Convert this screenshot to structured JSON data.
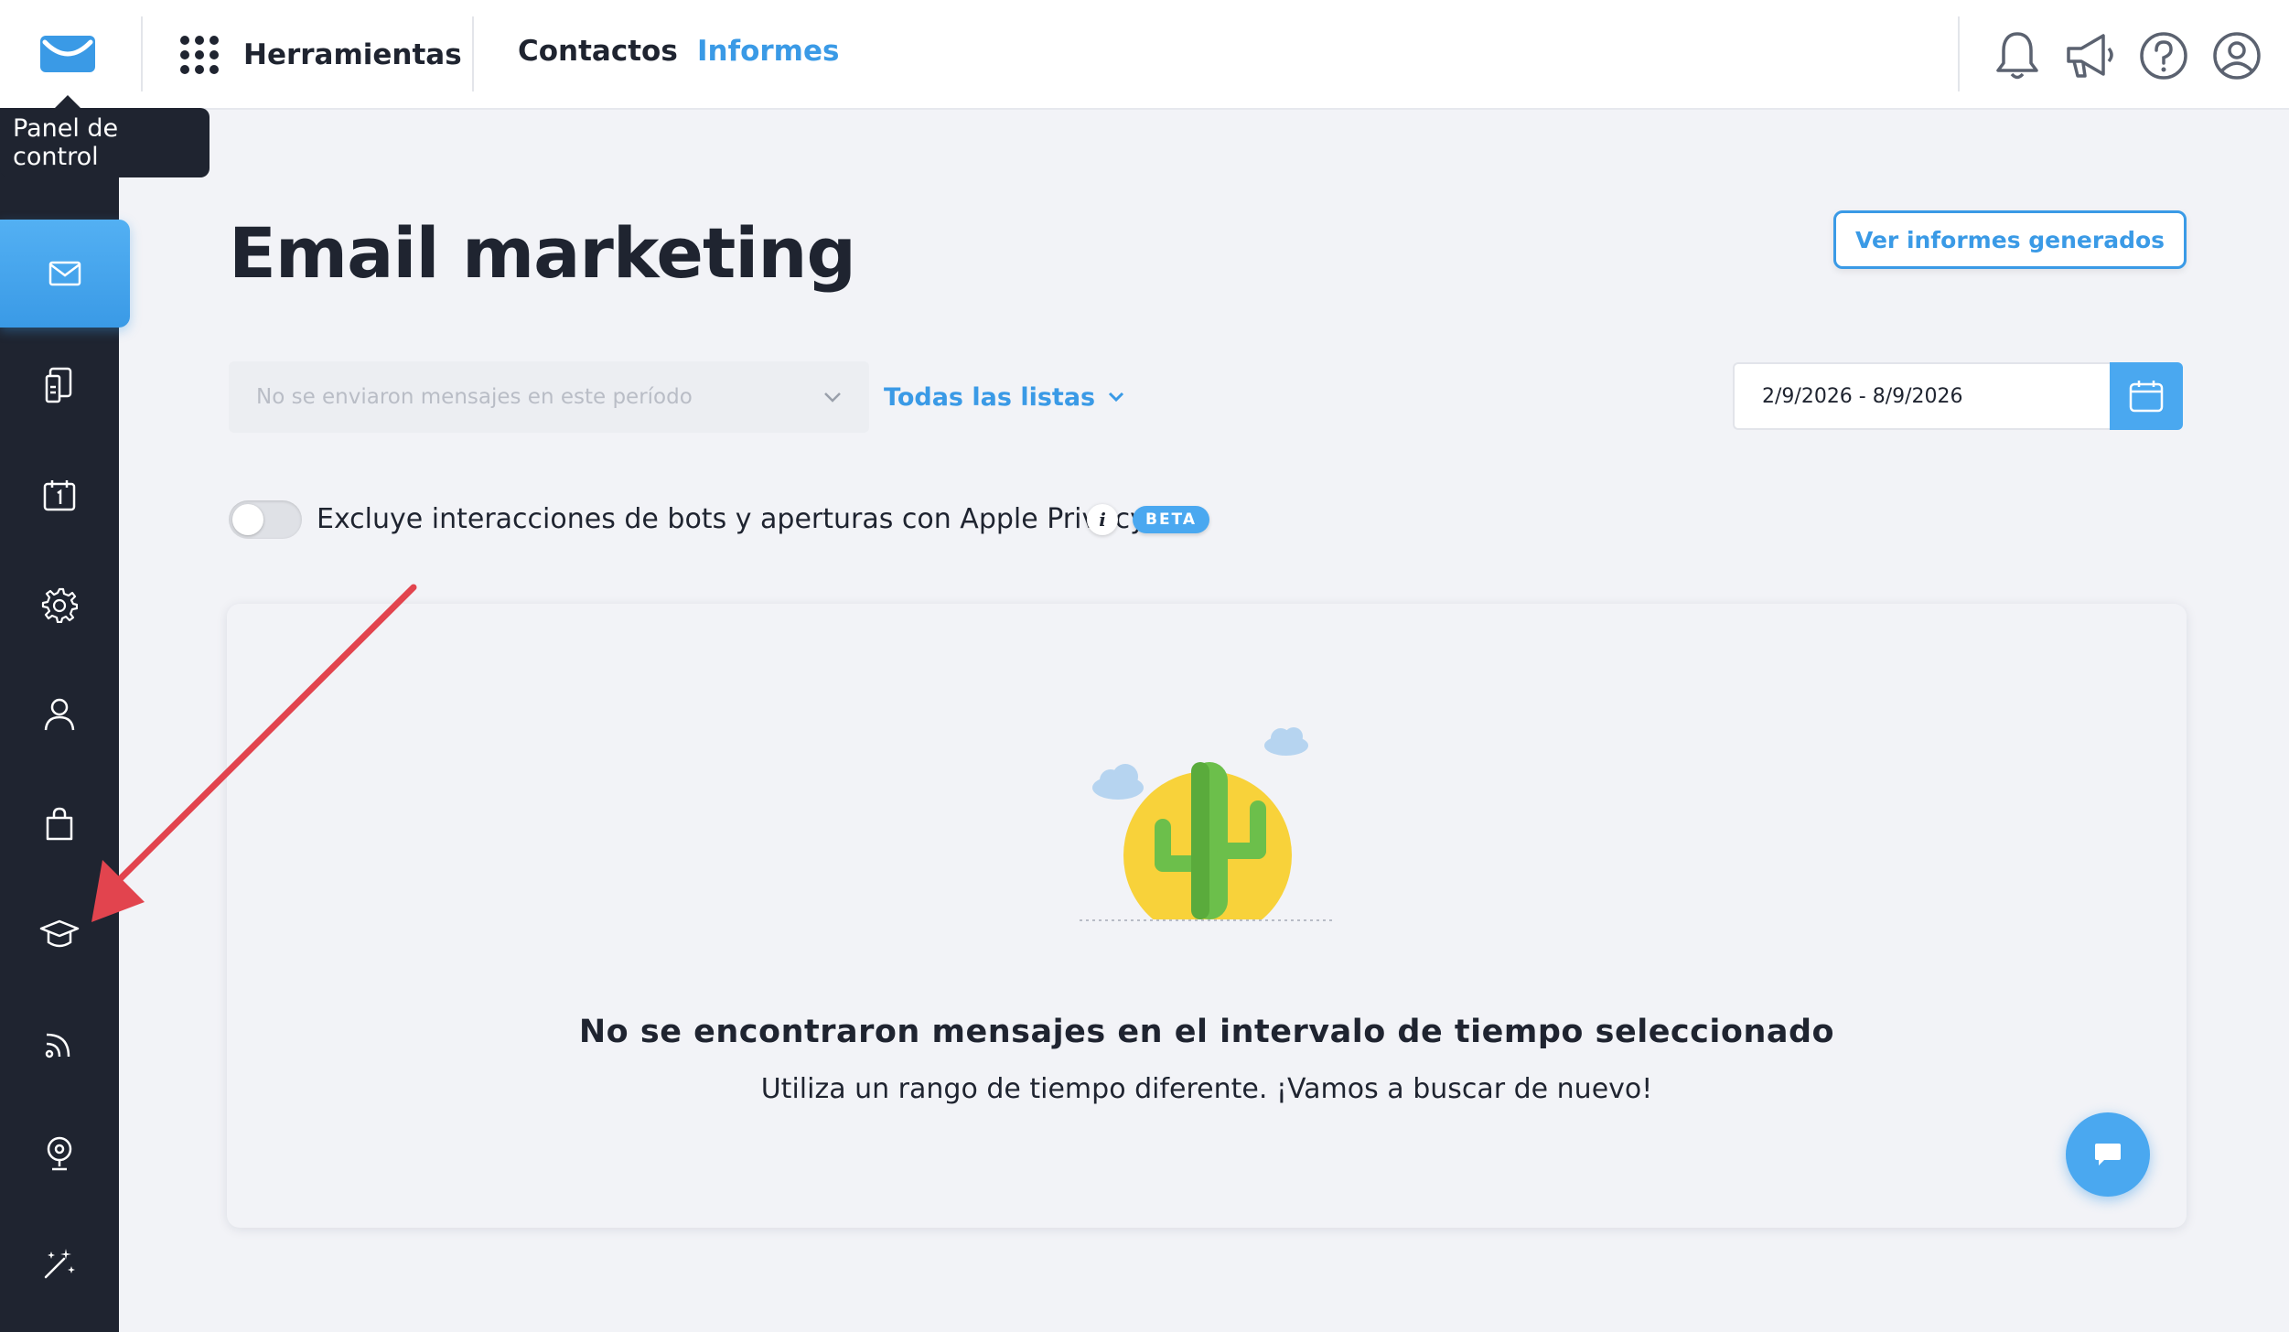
{
  "topbar": {
    "logo_icon": "getresponse-envelope-icon",
    "tools_label": "Herramientas",
    "nav": [
      {
        "label": "Contactos",
        "active": false
      },
      {
        "label": "Informes",
        "active": true
      }
    ],
    "icons": [
      "bell-icon",
      "megaphone-icon",
      "help-icon",
      "user-account-icon"
    ]
  },
  "tooltip": {
    "text": "Panel de control"
  },
  "sidebar": {
    "items": [
      {
        "icon": "email-icon",
        "active": true
      },
      {
        "icon": "landing-page-icon",
        "active": false
      },
      {
        "icon": "calendar-icon",
        "active": false
      },
      {
        "icon": "automation-gear-icon",
        "active": false
      },
      {
        "icon": "contacts-person-icon",
        "active": false
      },
      {
        "icon": "ecommerce-bag-icon",
        "active": false
      },
      {
        "icon": "courses-graduation-cap-icon",
        "active": false
      },
      {
        "icon": "rss-icon",
        "active": false
      },
      {
        "icon": "webinar-camera-icon",
        "active": false
      },
      {
        "icon": "magic-wand-icon",
        "active": false
      }
    ]
  },
  "main": {
    "title": "Email marketing",
    "view_reports_button": "Ver informes generados",
    "message_select_placeholder": "No se enviaron mensajes en este período",
    "lists_dropdown": "Todas las listas",
    "date_range": "2/9/2026 - 8/9/2026",
    "toggle": {
      "label": "Excluye interacciones de bots y aperturas con Apple Privacy",
      "on": false
    },
    "info_glyph": "i",
    "beta_badge": "BETA",
    "empty_state": {
      "title": "No se encontraron mensajes en el intervalo de tiempo seleccionado",
      "subtitle": "Utiliza un rango de tiempo diferente. ¡Vamos a buscar de nuevo!"
    }
  },
  "colors": {
    "accent": "#3a9ae6",
    "sidebar_bg": "#1f2430",
    "page_bg": "#f2f3f7",
    "annotation_arrow": "#e2444e"
  }
}
